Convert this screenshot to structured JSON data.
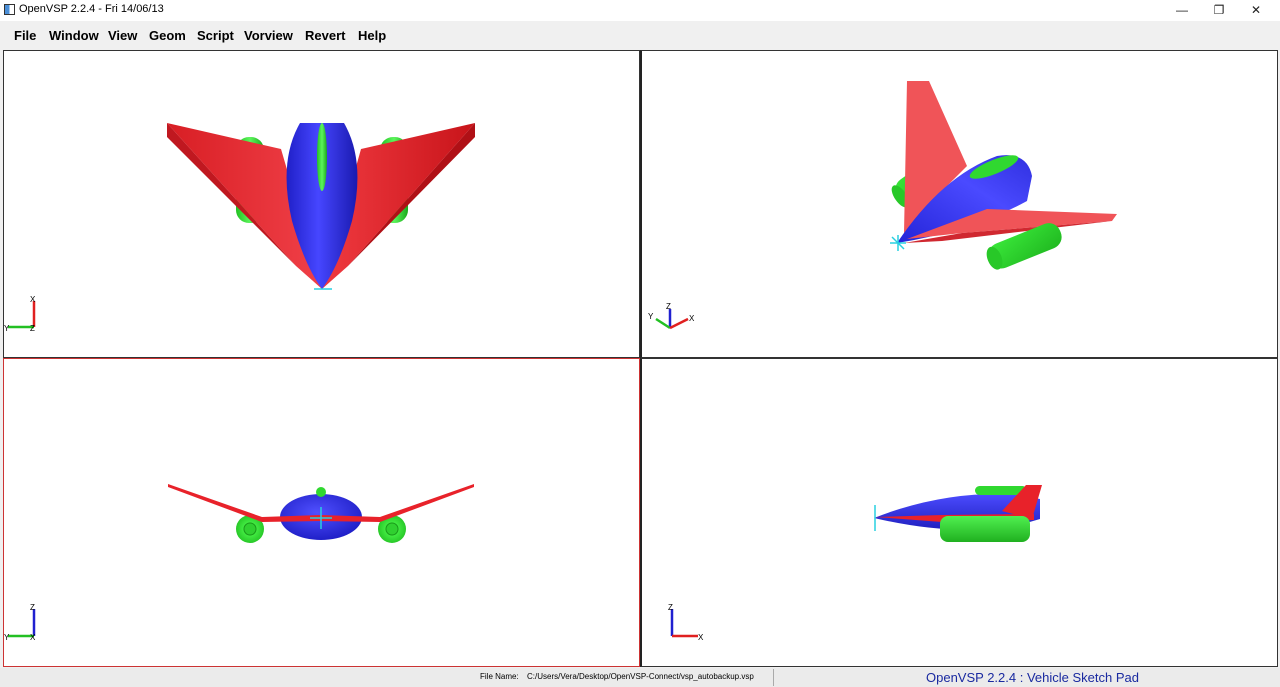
{
  "window": {
    "title": "OpenVSP 2.2.4 - Fri 14/06/13",
    "minimize_glyph": "—",
    "restore_glyph": "❐",
    "close_glyph": "✕"
  },
  "menu": {
    "items": [
      "File",
      "Window",
      "View",
      "Geom",
      "Script",
      "Vorview",
      "Revert",
      "Help"
    ]
  },
  "axes": {
    "x": "X",
    "y": "Y",
    "z": "Z"
  },
  "colors": {
    "fuselage": "#2d2df0",
    "wing": "#e8222a",
    "engine": "#2ee02e",
    "axis_x": "#e02020",
    "axis_y": "#22c022",
    "axis_z": "#2020d0",
    "cg_marker": "#28d0e0"
  },
  "status": {
    "file_label": "File Name:",
    "file_path": "C:/Users/Vera/Desktop/OpenVSP-Connect/vsp_autobackup.vsp",
    "app_name": "OpenVSP 2.2.4 : Vehicle Sketch Pad"
  }
}
